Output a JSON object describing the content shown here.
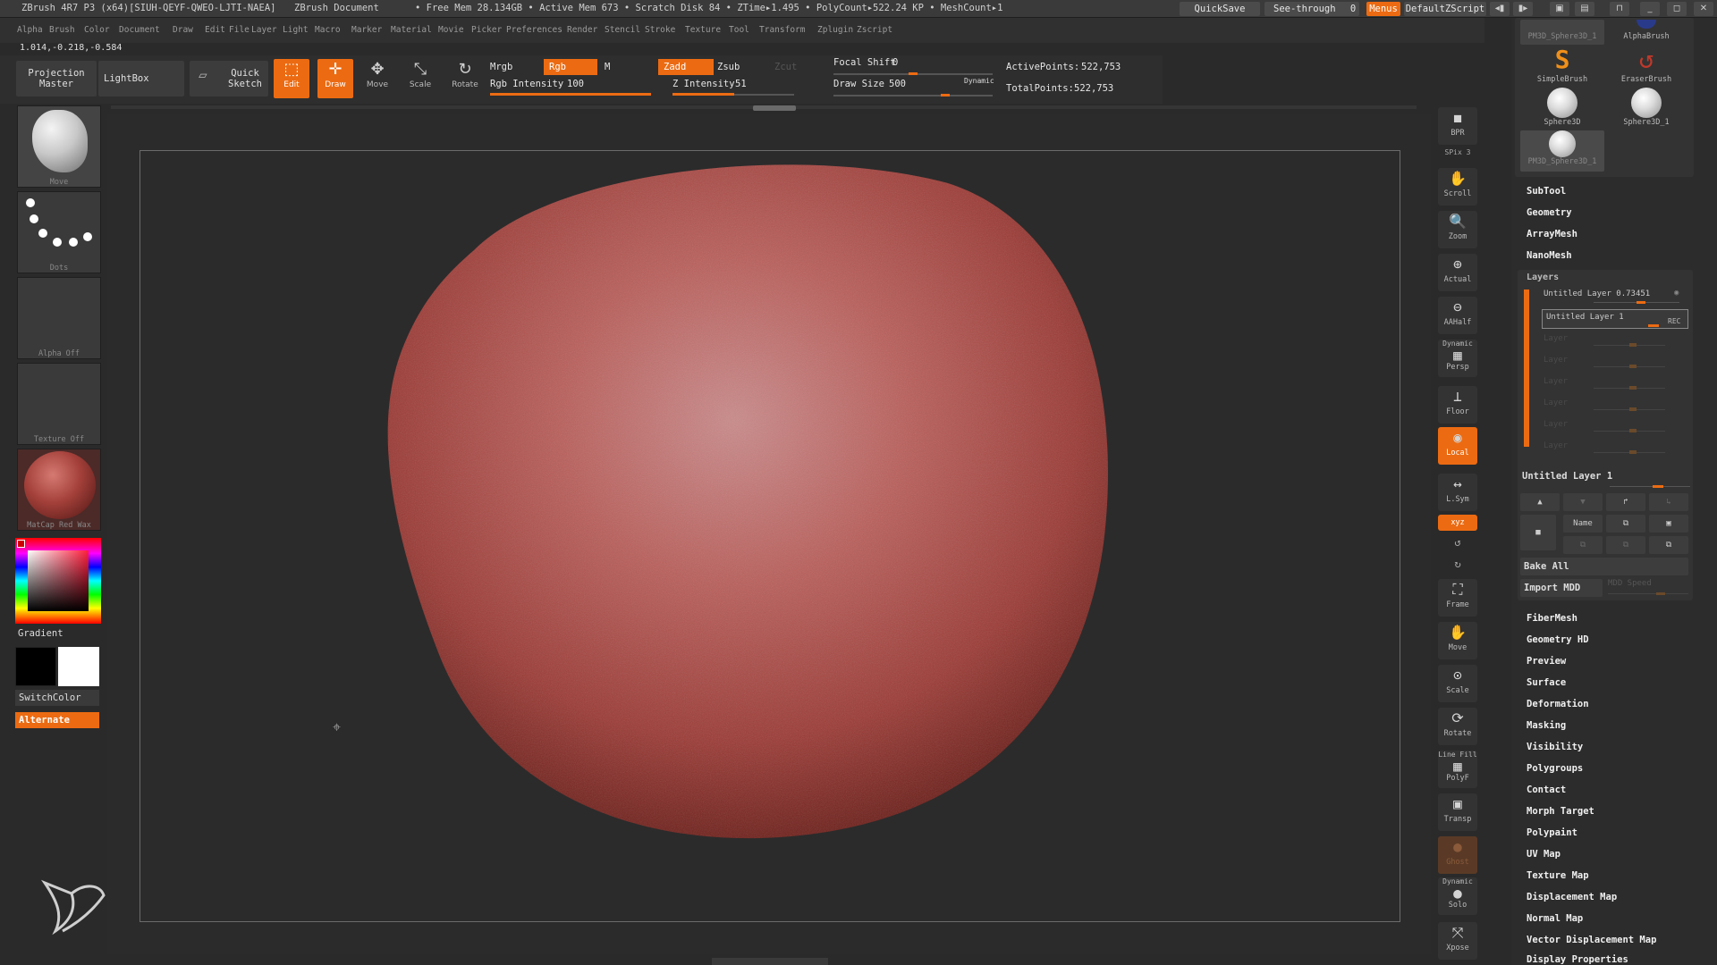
{
  "titlebar": {
    "app_title": "ZBrush 4R7 P3 (x64)[SIUH-QEYF-QWEO-LJTI-NAEA]",
    "document": "ZBrush Document",
    "stats": "• Free Mem 28.134GB • Active Mem 673 • Scratch Disk 84 • ZTime▸1.495 • PolyCount▸522.24 KP • MeshCount▸1",
    "quicksave": "QuickSave",
    "see_through_label": "See-through",
    "see_through_value": "0",
    "menus": "Menus",
    "script": "DefaultZScript"
  },
  "menubar": {
    "items": [
      "Alpha",
      "Brush",
      "Color",
      "Document",
      "Draw",
      "Edit",
      "File",
      "Layer",
      "Light",
      "Macro",
      "Marker",
      "Material",
      "Movie",
      "Picker",
      "Preferences",
      "Render",
      "Stencil",
      "Stroke",
      "Texture",
      "Tool",
      "Transform",
      "Zplugin",
      "Zscript"
    ]
  },
  "coords": "1.014,-0.218,-0.584",
  "shelf": {
    "projection_master": "Projection Master",
    "lightbox": "LightBox",
    "quick_sketch": "Quick Sketch",
    "edit": "Edit",
    "draw": "Draw",
    "move": "Move",
    "scale": "Scale",
    "rotate": "Rotate",
    "mrgb": "Mrgb",
    "rgb": "Rgb",
    "m": "M",
    "rgb_intensity_label": "Rgb Intensity",
    "rgb_intensity_value": "100",
    "rgb_intensity_fraction": 1.0,
    "zadd": "Zadd",
    "zsub": "Zsub",
    "zcut": "Zcut",
    "z_intensity_label": "Z Intensity",
    "z_intensity_value": "51",
    "z_intensity_fraction": 0.51,
    "focal_shift_label": "Focal Shift",
    "focal_shift_value": "0",
    "draw_size_label": "Draw Size",
    "draw_size_value": "500",
    "dynamic": "Dynamic",
    "active_points_label": "ActivePoints:",
    "active_points_value": "522,753",
    "total_points_label": "TotalPoints:",
    "total_points_value": "522,753"
  },
  "left_tray": {
    "brush_label": "Move",
    "stroke_label": "Dots",
    "alpha_label": "Alpha Off",
    "texture_label": "Texture Off",
    "material_label": "MatCap Red Wax",
    "gradient": "Gradient",
    "switch_color": "SwitchColor",
    "alternate": "Alternate"
  },
  "right_shelf": {
    "bpr": "BPR",
    "spix_label": "SPix",
    "spix_value": "3",
    "scroll": "Scroll",
    "zoom": "Zoom",
    "actual": "Actual",
    "aahalf": "AAHalf",
    "dynamic": "Dynamic",
    "persp": "Persp",
    "floor": "Floor",
    "local": "Local",
    "lsym": "L.Sym",
    "xyz": "xyz",
    "frame": "Frame",
    "move": "Move",
    "scale": "Scale",
    "rotate": "Rotate",
    "line_fill": "Line Fill",
    "polyf": "PolyF",
    "transp": "Transp",
    "ghost": "Ghost",
    "dynamic2": "Dynamic",
    "solo": "Solo",
    "xpose": "Xpose"
  },
  "palette": {
    "tools": [
      {
        "name": "PM3D_Sphere3D_1"
      },
      {
        "name": "AlphaBrush"
      },
      {
        "name": "SimpleBrush"
      },
      {
        "name": "EraserBrush"
      },
      {
        "name": "Sphere3D"
      },
      {
        "name": "Sphere3D_1"
      },
      {
        "name": "PM3D_Sphere3D_1"
      }
    ],
    "subtool": "SubTool",
    "geometry": "Geometry",
    "arraymesh": "ArrayMesh",
    "nanomesh": "NanoMesh",
    "layers": "Layers",
    "layer1_name": "Untitled Layer 0.73451",
    "layer2_name": "Untitled Layer 1",
    "layer2_rec": "REC",
    "empty_layers": [
      "Layer",
      "Layer",
      "Layer",
      "Layer",
      "Layer",
      "Layer"
    ],
    "current_layer": "Untitled Layer 1",
    "name_btn": "Name",
    "bake_all": "Bake All",
    "import_mdd": "Import MDD",
    "mdd_speed": "MDD Speed",
    "sections": [
      "FiberMesh",
      "Geometry HD",
      "Preview",
      "Surface",
      "Deformation",
      "Masking",
      "Visibility",
      "Polygroups",
      "Contact",
      "Morph Target",
      "Polypaint",
      "UV Map",
      "Texture Map",
      "Displacement Map",
      "Normal Map",
      "Vector Displacement Map",
      "Display Properties"
    ]
  },
  "colors": {
    "accent": "#ec6b12",
    "mesh": "#b4504e",
    "background": "#2a2a2a"
  }
}
